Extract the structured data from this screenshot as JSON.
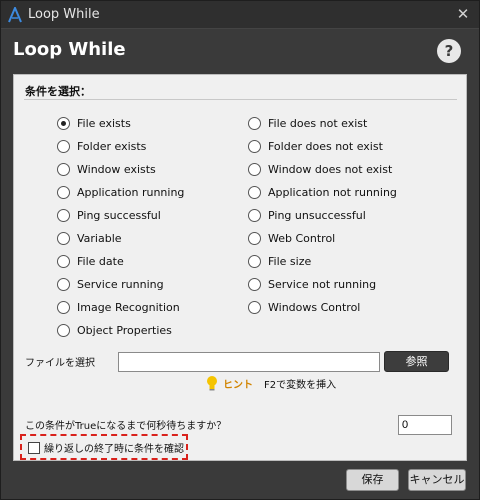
{
  "window": {
    "title": "Loop While",
    "close_glyph": "✕"
  },
  "header": {
    "title": "Loop While",
    "help_label": "?"
  },
  "conditions": {
    "label": "条件を選択：",
    "left": [
      {
        "label": "File exists",
        "checked": true
      },
      {
        "label": "Folder exists",
        "checked": false
      },
      {
        "label": "Window exists",
        "checked": false
      },
      {
        "label": "Application running",
        "checked": false
      },
      {
        "label": "Ping successful",
        "checked": false
      },
      {
        "label": "Variable",
        "checked": false
      },
      {
        "label": "File date",
        "checked": false
      },
      {
        "label": "Service running",
        "checked": false
      },
      {
        "label": "Image Recognition",
        "checked": false
      },
      {
        "label": "Object Properties",
        "checked": false
      }
    ],
    "right": [
      {
        "label": "File does not exist",
        "checked": false
      },
      {
        "label": "Folder does not exist",
        "checked": false
      },
      {
        "label": "Window does not exist",
        "checked": false
      },
      {
        "label": "Application not running",
        "checked": false
      },
      {
        "label": "Ping unsuccessful",
        "checked": false
      },
      {
        "label": "Web Control",
        "checked": false
      },
      {
        "label": "File size",
        "checked": false
      },
      {
        "label": "Service not running",
        "checked": false
      },
      {
        "label": "Windows Control",
        "checked": false
      }
    ]
  },
  "file": {
    "label": "ファイルを選択",
    "value": "",
    "browse_label": "参照"
  },
  "hint": {
    "word": "ヒント",
    "text": "F2で変数を挿入"
  },
  "wait": {
    "label": "この条件がTrueになるまで何秒待ちますか？",
    "value": "0"
  },
  "check_at_end": {
    "label": "繰り返しの終了時に条件を確認",
    "checked": false
  },
  "footer": {
    "save_label": "保存",
    "cancel_label": "キャンセル"
  },
  "colors": {
    "accent_hint": "#d18400",
    "highlight_border": "#d9221c",
    "titlebar": "#2f2f2f"
  }
}
